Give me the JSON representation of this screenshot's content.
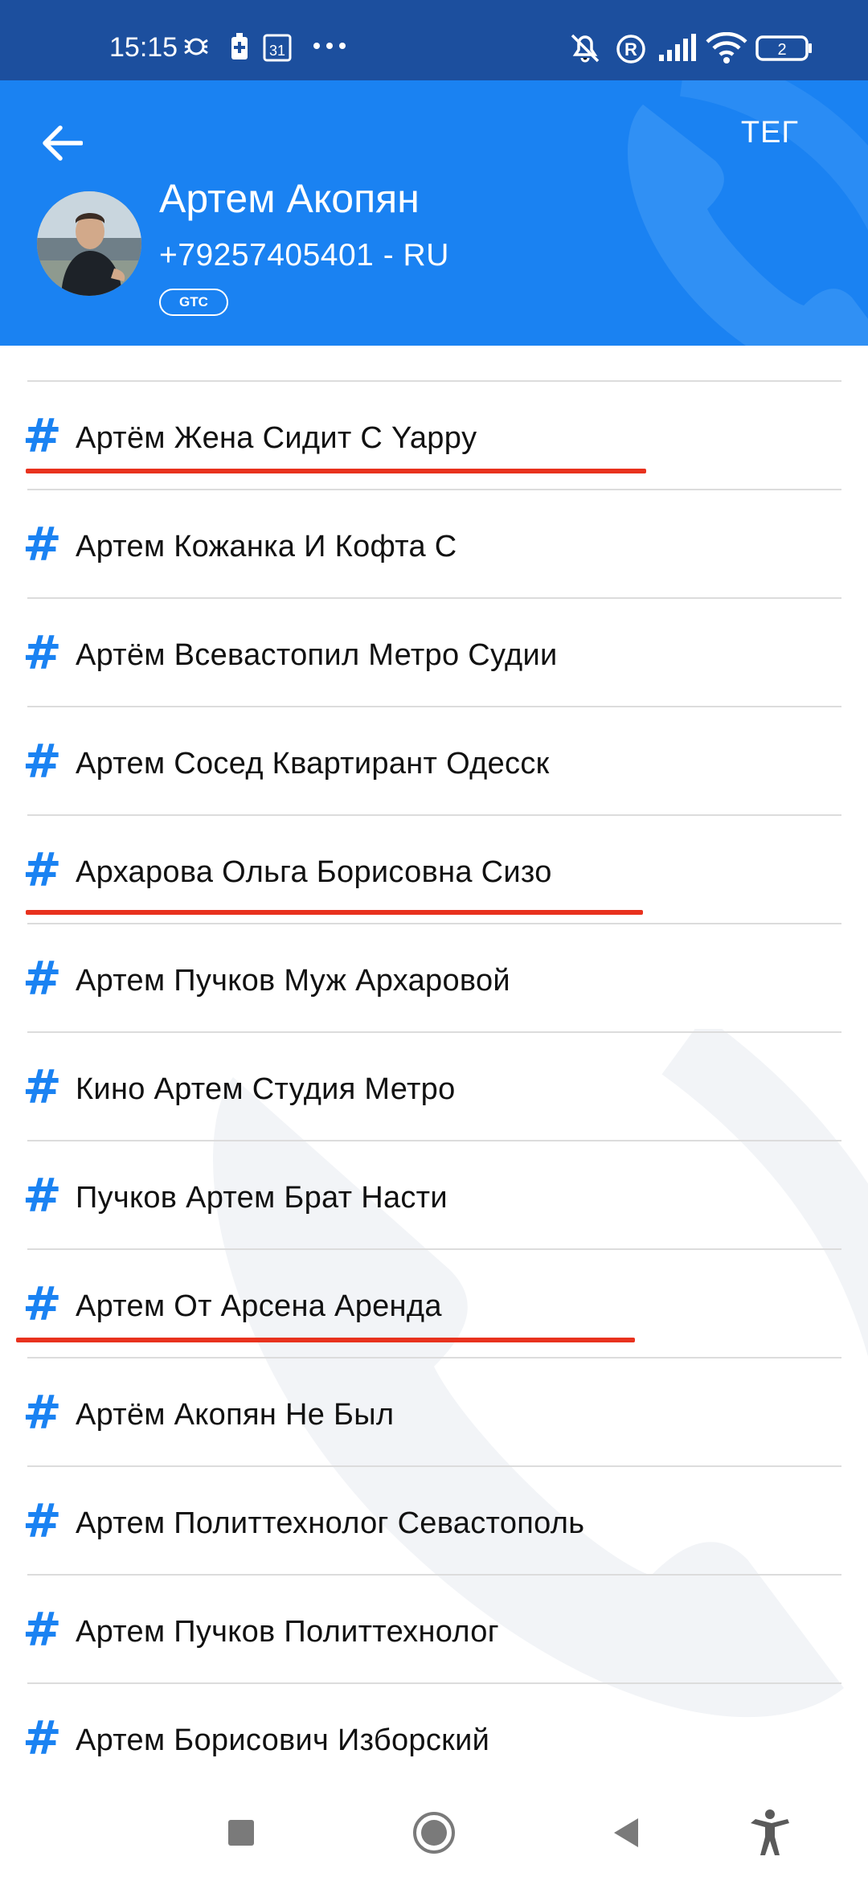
{
  "status": {
    "time": "15:15",
    "calendar_day": "31",
    "battery": "2",
    "icons": [
      "bug-icon",
      "battery-saver-icon",
      "calendar-icon",
      "more-dots-icon",
      "mute-icon",
      "registered-icon",
      "signal-icon",
      "wifi-icon",
      "battery-icon"
    ]
  },
  "header": {
    "tag_button": "ТЕГ",
    "name": "Артем Акопян",
    "phone": "+79257405401 - RU",
    "badge": "GTC",
    "background_color": "#1a82f2"
  },
  "tags": [
    {
      "label": "Артём Жена Сидит С Yappy"
    },
    {
      "label": "Артем Кожанка И Кофта С"
    },
    {
      "label": "Артём Всевастопил Метро Судии"
    },
    {
      "label": "Артем Сосед Квартирант Одесск"
    },
    {
      "label": "Архарова Ольга Борисовна Сизо"
    },
    {
      "label": "Артем Пучков Муж Архаровой"
    },
    {
      "label": "Кино Артем Студия Метро"
    },
    {
      "label": "Пучков Артем Брат Насти"
    },
    {
      "label": "Артем От Арсена Аренда"
    },
    {
      "label": "Артём Акопян Не Был"
    },
    {
      "label": "Артем Политтехнолог Севастополь"
    },
    {
      "label": "Артем Пучков Политтехнолог"
    },
    {
      "label": "Артем Борисович Изборский"
    }
  ],
  "hash_symbol": "#",
  "underline_color": "#e8321e",
  "nav": [
    "recents-button",
    "home-button",
    "back-button",
    "accessibility-button"
  ]
}
